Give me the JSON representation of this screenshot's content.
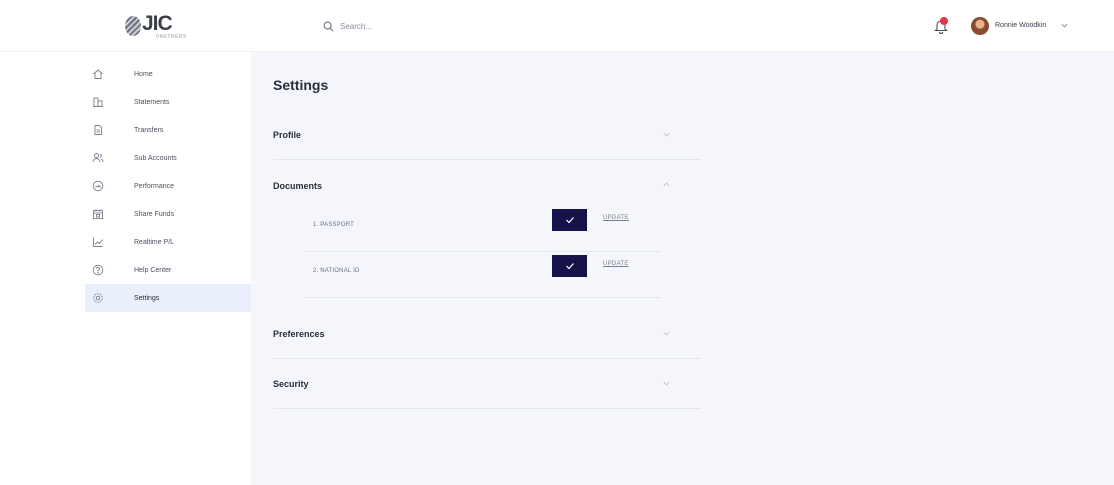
{
  "brand": {
    "logo_main": "JIC",
    "logo_sub": "PARTNERS"
  },
  "search": {
    "placeholder": "Search..."
  },
  "user": {
    "name": "Ronnie Woodkin"
  },
  "sidebar": {
    "items": [
      {
        "label": "Home",
        "icon": "home-icon"
      },
      {
        "label": "Statements",
        "icon": "buildings-icon"
      },
      {
        "label": "Transfers",
        "icon": "document-icon"
      },
      {
        "label": "Sub Accounts",
        "icon": "users-icon"
      },
      {
        "label": "Performance",
        "icon": "gauge-icon"
      },
      {
        "label": "Share Funds",
        "icon": "calendar-icon"
      },
      {
        "label": "Realtime P/L",
        "icon": "line-chart-icon"
      },
      {
        "label": "Help Center",
        "icon": "help-icon"
      },
      {
        "label": "Settings",
        "icon": "gear-icon",
        "active": true
      }
    ]
  },
  "main": {
    "title": "Settings",
    "sections": [
      {
        "title": "Profile",
        "expanded": false
      },
      {
        "title": "Documents",
        "expanded": true
      },
      {
        "title": "Preferences",
        "expanded": false
      },
      {
        "title": "Security",
        "expanded": false
      }
    ],
    "documents": [
      {
        "label": "1. PASSPORT",
        "action": "UPDATE"
      },
      {
        "label": "2. NATIONAL ID",
        "action": "UPDATE"
      }
    ]
  },
  "colors": {
    "accent": "#15124a",
    "active_nav_bg": "#e9effb",
    "main_bg": "#f4f6fb",
    "notification": "#e23744"
  }
}
